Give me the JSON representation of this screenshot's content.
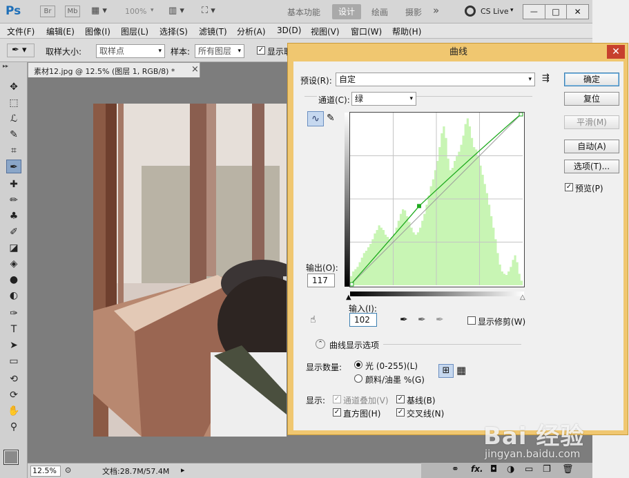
{
  "app": {
    "logo": "Ps",
    "logo_color": "#1e6fb8",
    "bridge": "Br",
    "minibridge": "Mb",
    "zoom": "100%",
    "workspaces": [
      "基本功能",
      "设计",
      "绘画",
      "摄影"
    ],
    "active_workspace": "设计",
    "more": "»",
    "cslive": "CS Live",
    "window_buttons": [
      "—",
      "□",
      "✕"
    ]
  },
  "menu": [
    "文件(F)",
    "编辑(E)",
    "图像(I)",
    "图层(L)",
    "选择(S)",
    "滤镜(T)",
    "分析(A)",
    "3D(D)",
    "视图(V)",
    "窗口(W)",
    "帮助(H)"
  ],
  "options": {
    "sample_size_label": "取样大小:",
    "sample_size_value": "取样点",
    "sample_label": "样本:",
    "sample_value": "所有图层",
    "show_ring": "显示取"
  },
  "document": {
    "tab_title": "素材12.jpg @ 12.5% (图层 1, RGB/8) *",
    "tab_close": "×"
  },
  "status": {
    "zoom": "12.5%",
    "doc_info": "文档:28.7M/57.4M"
  },
  "tools": [
    "move-icon",
    "marquee-icon",
    "lasso-icon",
    "quick-select-icon",
    "crop-icon",
    "eyedropper-icon",
    "healing-icon",
    "brush-icon",
    "stamp-icon",
    "history-brush-icon",
    "eraser-icon",
    "bucket-icon",
    "blur-icon",
    "dodge-icon",
    "pen-icon",
    "type-icon",
    "path-select-icon",
    "shape-icon",
    "3d-rotate-icon",
    "3d-orbit-icon",
    "hand-icon",
    "zoom-icon"
  ],
  "tool_glyphs": [
    "✥",
    "⬚",
    "ℒ",
    "✎",
    "⌗",
    "✒",
    "✚",
    "✏",
    "♣",
    "✐",
    "◪",
    "◈",
    "●",
    "◐",
    "✑",
    "T",
    "➤",
    "▭",
    "⟲",
    "⟳",
    "✋",
    "⚲"
  ],
  "curves": {
    "title": "曲线",
    "close": "✕",
    "preset_label": "预设(R):",
    "preset_value": "自定",
    "channel_label": "通道(C):",
    "channel_value": "绿",
    "output_label": "输出(O):",
    "output_value": "117",
    "input_label": "输入(I):",
    "input_value": "102",
    "show_clipping": "显示修剪(W)",
    "display_options": "曲线显示选项",
    "show_amount_label": "显示数量:",
    "light_option": "光 (0-255)(L)",
    "pigment_option": "颜料/油墨 %(G)",
    "show_label": "显示:",
    "channel_overlays": "通道叠加(V)",
    "baseline": "基线(B)",
    "histogram": "直方图(H)",
    "intersection": "交叉线(N)",
    "buttons": {
      "ok": "确定",
      "reset": "复位",
      "smooth": "平滑(M)",
      "auto": "自动(A)",
      "options": "选项(T)...",
      "preview": "预览(P)"
    },
    "control_point": {
      "input": 102,
      "output": 117
    },
    "curve_color": "#1faa1f",
    "histogram_color": "#c8f5b4",
    "histogram_values": [
      8,
      12,
      14,
      16,
      20,
      24,
      28,
      30,
      33,
      36,
      40,
      45,
      48,
      52,
      50,
      48,
      44,
      42,
      40,
      42,
      45,
      50,
      56,
      62,
      66,
      65,
      60,
      55,
      50,
      46,
      44,
      46,
      50,
      56,
      62,
      70,
      78,
      86,
      92,
      100,
      108,
      120,
      132,
      138,
      128,
      110,
      100,
      102,
      108,
      112,
      116,
      122,
      130,
      140,
      145,
      138,
      128,
      120,
      118,
      112,
      104,
      96,
      88,
      80,
      70,
      60,
      50,
      40,
      28,
      18,
      12,
      10,
      9,
      12,
      16,
      22,
      26,
      20,
      10,
      4
    ]
  },
  "watermark": {
    "brand": "Bai 经验",
    "url": "jingyan.baidu.com"
  }
}
